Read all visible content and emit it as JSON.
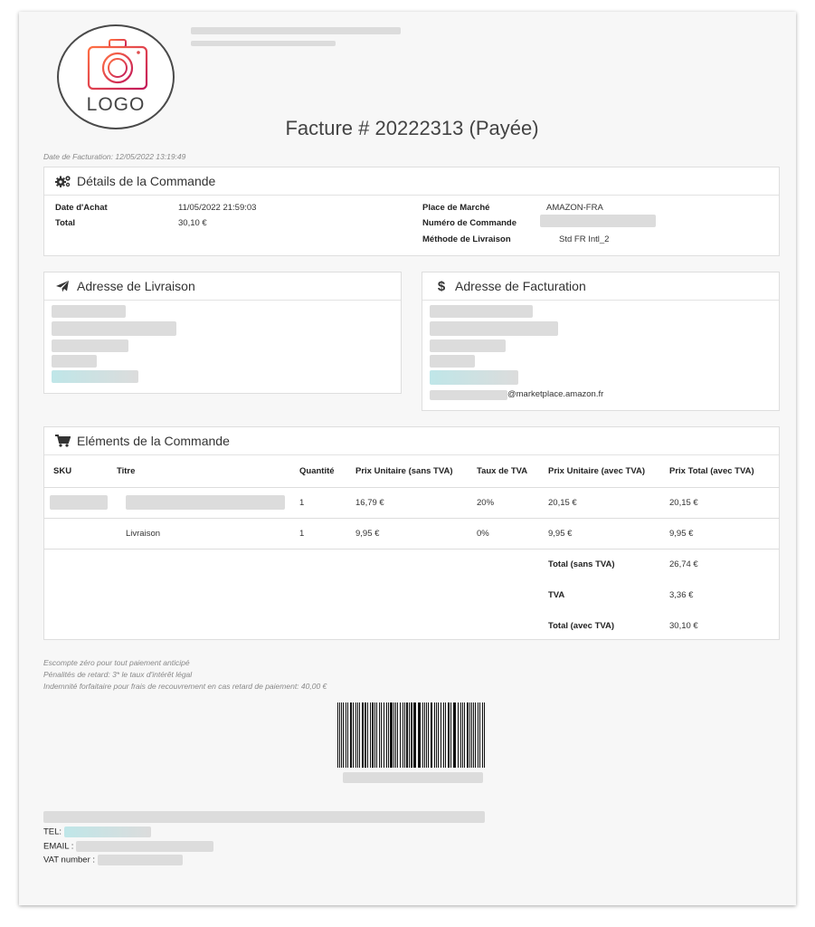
{
  "logo": {
    "text": "LOGO",
    "icon": "camera-icon",
    "brand_gradient": [
      "#ff6b4a",
      "#c2185b"
    ]
  },
  "header": {
    "title": "Facture # 20222313 (Payée)",
    "invoice_date": "Date de Facturation: 12/05/2022 13:19:49"
  },
  "order_details": {
    "heading": "Détails de la Commande",
    "icon": "gears-icon",
    "purchase_date_label": "Date d'Achat",
    "purchase_date_value": "11/05/2022 21:59:03",
    "total_label": "Total",
    "total_value": "30,10 €",
    "marketplace_label": "Place de Marché",
    "marketplace_value": "AMAZON-FRA",
    "order_number_label": "Numéro de Commande",
    "shipping_method_label": "Méthode de Livraison",
    "shipping_method_value": "Std FR Intl_2"
  },
  "shipping_address": {
    "heading": "Adresse de Livraison",
    "icon": "paper-plane-icon"
  },
  "billing_address": {
    "heading": "Adresse de Facturation",
    "icon": "dollar-icon",
    "email_suffix": "@marketplace.amazon.fr"
  },
  "items": {
    "heading": "Eléments de la Commande",
    "icon": "cart-icon",
    "columns": [
      "SKU",
      "Titre",
      "Quantité",
      "Prix Unitaire (sans TVA)",
      "Taux de TVA",
      "Prix Unitaire (avec TVA)",
      "Prix Total (avec TVA)"
    ],
    "rows": [
      {
        "sku": "",
        "title": "",
        "qty": "1",
        "unit_ht": "16,79 €",
        "vat_rate": "20%",
        "unit_ttc": "20,15 €",
        "total_ttc": "20,15 €"
      },
      {
        "sku": "",
        "title": "Livraison",
        "qty": "1",
        "unit_ht": "9,95 €",
        "vat_rate": "0%",
        "unit_ttc": "9,95 €",
        "total_ttc": "9,95 €"
      }
    ],
    "totals": [
      {
        "label": "Total (sans TVA)",
        "value": "26,74 €"
      },
      {
        "label": "TVA",
        "value": "3,36 €"
      },
      {
        "label": "Total (avec TVA)",
        "value": "30,10 €"
      }
    ]
  },
  "notes": [
    "Escompte zéro pour tout paiement anticipé",
    "Pénalités de retard: 3* le taux d'intérêt légal",
    "Indemnité forfaitaire pour frais de recouvrement en cas retard de paiement: 40,00 €"
  ],
  "footer": {
    "tel_label": "TEL:",
    "email_label": "EMAIL :",
    "vat_label": "VAT number :"
  }
}
